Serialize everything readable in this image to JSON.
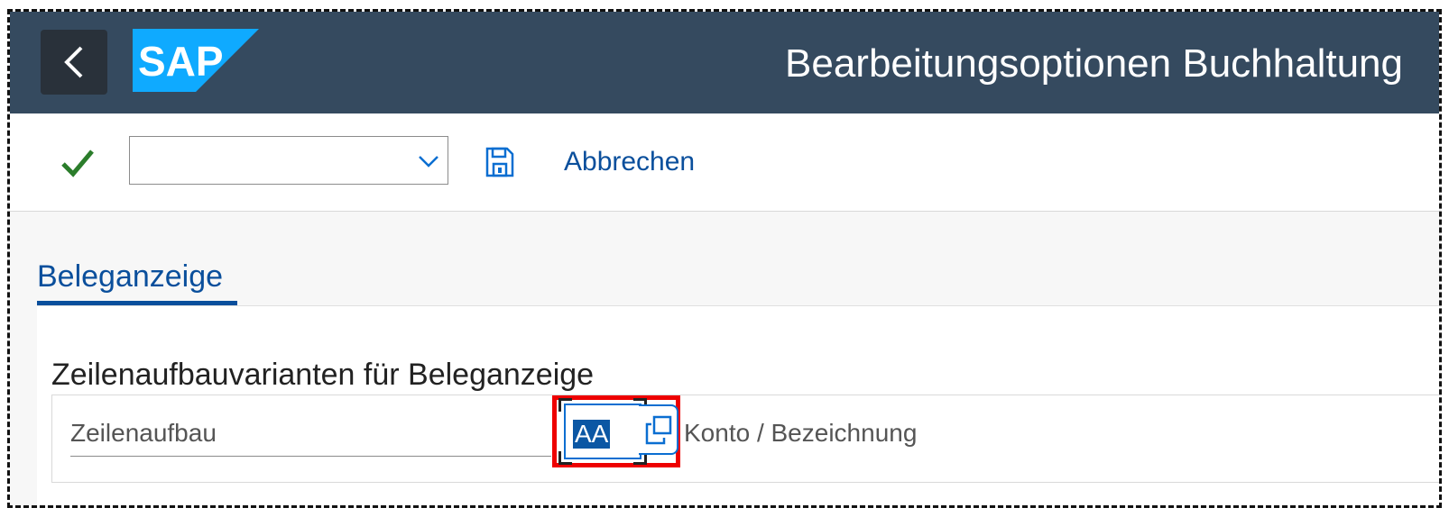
{
  "header": {
    "back_icon": "chevron-left-icon",
    "logo_text": "SAP",
    "title": "Bearbeitungsoptionen Buchhaltung",
    "colors": {
      "shell": "#354a5f",
      "logo": "#0faaff"
    }
  },
  "toolbar": {
    "ok_icon": "checkmark-icon",
    "command_field": {
      "value": "",
      "placeholder": ""
    },
    "dropdown_icon": "chevron-down-icon",
    "save_icon": "save-icon",
    "cancel_label": "Abbrechen"
  },
  "tabs": [
    {
      "label": "Beleganzeige",
      "selected": true
    }
  ],
  "section": {
    "title": "Zeilenaufbauvarianten für Beleganzeige",
    "field": {
      "label": "Zeilenaufbau",
      "value": "AA",
      "value_help_icon": "value-help-icon",
      "description": "Konto / Bezeichnung"
    }
  }
}
